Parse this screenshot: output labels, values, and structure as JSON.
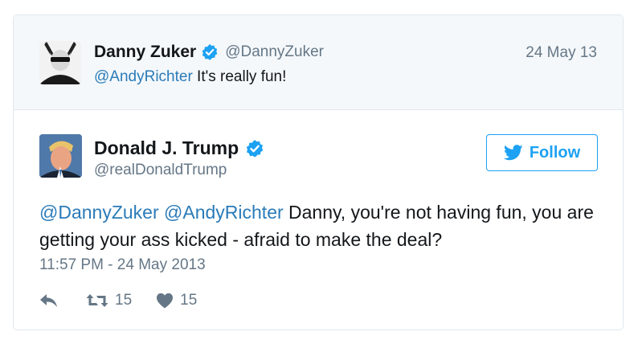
{
  "quoted_tweet": {
    "author_name": "Danny Zuker",
    "author_handle": "@DannyZuker",
    "date": "24 May 13",
    "mention": "@AndyRichter",
    "text": " It's really fun!"
  },
  "tweet": {
    "author_name": "Donald J. Trump",
    "author_handle": "@realDonaldTrump",
    "follow_label": "Follow",
    "mention_1": "@DannyZuker",
    "mention_2": "@AndyRichter",
    "text": " Danny, you're not having fun, you are getting your ass kicked - afraid to make the deal?",
    "timestamp": "11:57 PM - 24 May 2013",
    "retweet_count": "15",
    "like_count": "15"
  },
  "icons": {
    "verified": "verified-badge-icon",
    "bird": "twitter-bird-icon",
    "reply": "reply-icon",
    "retweet": "retweet-icon",
    "like": "heart-icon"
  },
  "colors": {
    "link": "#2b7bb9",
    "accent": "#1da1f2",
    "muted": "#657786",
    "quoted_background": "#f5f8fa"
  }
}
